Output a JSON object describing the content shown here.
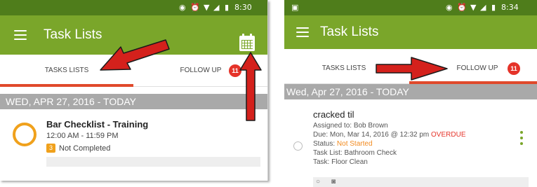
{
  "left_screen": {
    "status_bar": {
      "time": "8:30"
    },
    "app_bar": {
      "title": "Task Lists"
    },
    "tabs": [
      {
        "label": "TASKS LISTS",
        "selected": true
      },
      {
        "label": "FOLLOW UP",
        "selected": false,
        "badge": "11"
      }
    ],
    "date_header": "WED, APR 27, 2016 - TODAY",
    "item": {
      "title": "Bar Checklist - Training",
      "time": "12:00 AM - 11:59 PM",
      "count": "3",
      "status": "Not Completed"
    }
  },
  "right_screen": {
    "status_bar": {
      "time": "8:34"
    },
    "app_bar": {
      "title": "Task Lists"
    },
    "tabs": [
      {
        "label": "TASKS LISTS",
        "selected": false
      },
      {
        "label": "FOLLOW UP",
        "selected": true,
        "badge": "11"
      }
    ],
    "date_header": "Wed, Apr 27, 2016 - TODAY",
    "item": {
      "title": "cracked til",
      "assigned_label": "Assigned to:",
      "assigned_value": "Bob Brown",
      "due_label": "Due:",
      "due_value": "Mon, Mar 14, 2016 @ 12:32 pm",
      "due_flag": "OVERDUE",
      "status_label": "Status:",
      "status_value": "Not Started",
      "task_list_label": "Task List:",
      "task_list_value": "Bathroom Check",
      "task_label": "Task:",
      "task_value": "Floor Clean"
    }
  },
  "colors": {
    "app_bar": "#7aa62a",
    "status_bar": "#4f7d1b",
    "tab_indicator": "#e0492b",
    "badge": "#e53329",
    "pending": "#f0a11c",
    "arrow": "#d4211c"
  },
  "icons": [
    "menu-icon",
    "calendar-icon",
    "comment-icon",
    "camera-icon",
    "more-vert-icon"
  ]
}
